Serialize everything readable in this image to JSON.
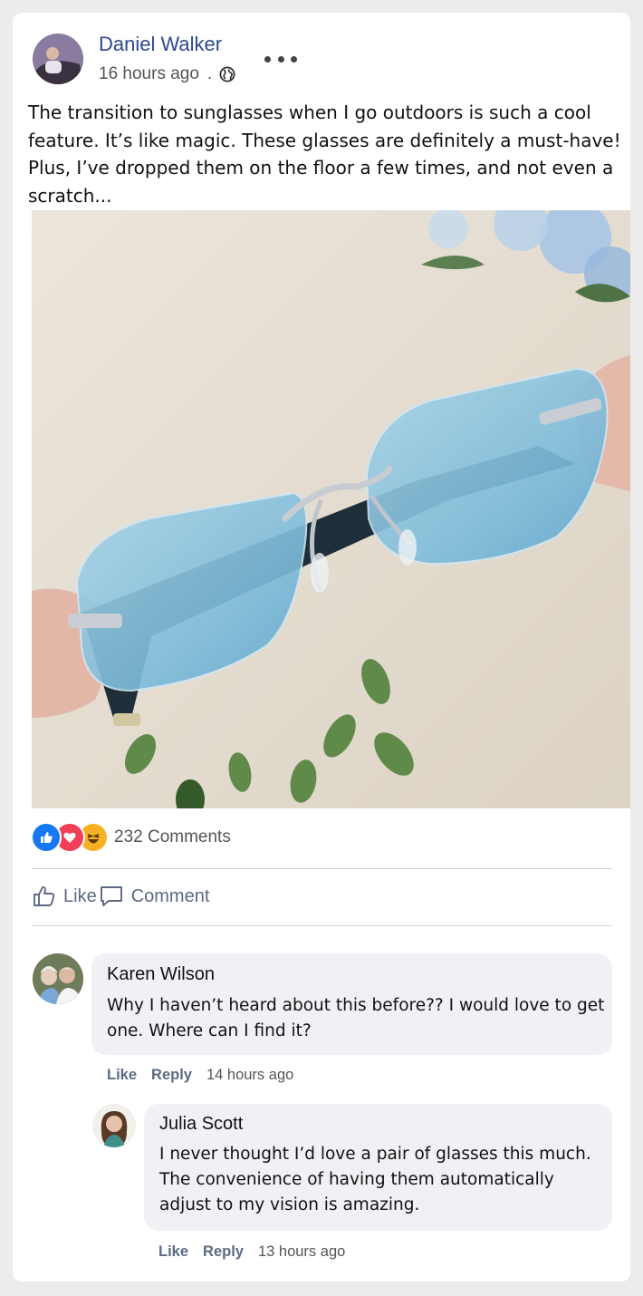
{
  "post": {
    "author": "Daniel Walker",
    "time": "16 hours ago",
    "separator": ".",
    "text": "The transition to sunglasses when I go outdoors is such a cool feature. It’s like magic. These glasses are definitely a must-have! Plus, I’ve dropped them on the floor a few times, and not even a scratch..."
  },
  "stats": {
    "comments_count": "232 Comments",
    "reactions": [
      "like",
      "love",
      "haha"
    ]
  },
  "actions": {
    "like_label": "Like",
    "comment_label": "Comment"
  },
  "comments": [
    {
      "name": "Karen Wilson",
      "text": "Why I haven’t heard about this before?? I would love to get one. Where can I find it?",
      "like_label": "Like",
      "reply_label": "Reply",
      "time": "14 hours ago"
    },
    {
      "name": "Julia Scott",
      "text": "I never thought I’d love a pair of glasses this much. The convenience of having them automatically adjust to my vision is amazing.",
      "like_label": "Like",
      "reply_label": "Reply",
      "time": "13 hours ago"
    }
  ],
  "colors": {
    "author_link": "#2c4a8f",
    "like_blue": "#1877f2",
    "love_red": "#f33e58",
    "haha_yellow": "#f7b125",
    "bubble": "#eff1f4"
  }
}
